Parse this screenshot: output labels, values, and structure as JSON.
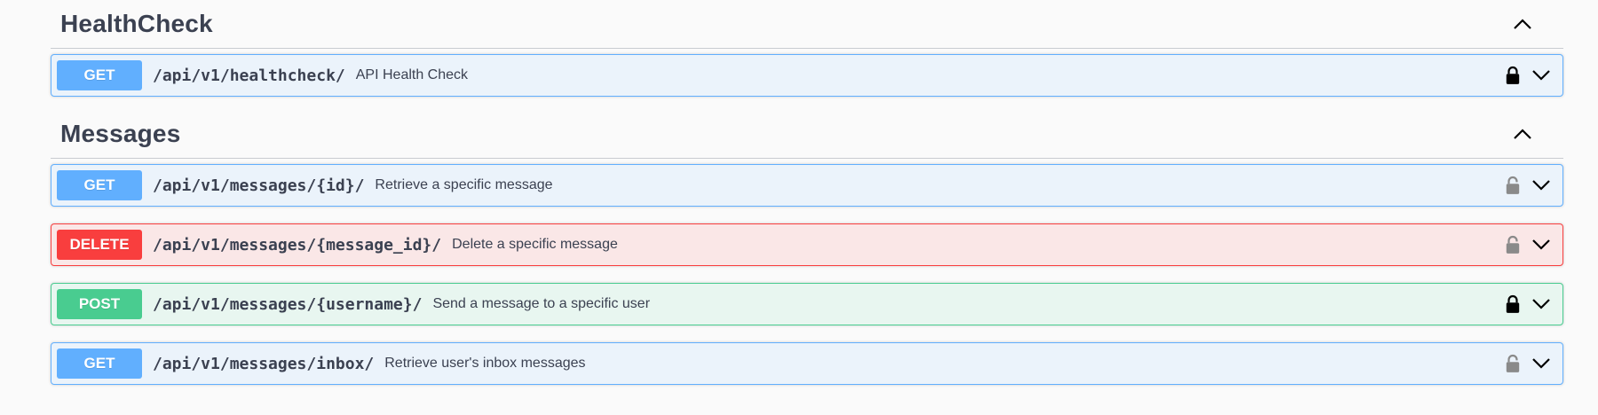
{
  "sections": [
    {
      "title": "HealthCheck",
      "ops": [
        {
          "method": "GET",
          "path": "/api/v1/healthcheck/",
          "summary": "API Health Check",
          "lock": "locked"
        }
      ]
    },
    {
      "title": "Messages",
      "ops": [
        {
          "method": "GET",
          "path": "/api/v1/messages/{id}/",
          "summary": "Retrieve a specific message",
          "lock": "unlocked"
        },
        {
          "method": "DELETE",
          "path": "/api/v1/messages/{message_id}/",
          "summary": "Delete a specific message",
          "lock": "unlocked"
        },
        {
          "method": "POST",
          "path": "/api/v1/messages/{username}/",
          "summary": "Send a message to a specific user",
          "lock": "locked"
        },
        {
          "method": "GET",
          "path": "/api/v1/messages/inbox/",
          "summary": "Retrieve user's inbox messages",
          "lock": "unlocked"
        }
      ]
    }
  ],
  "icons": {
    "section_toggle": "chevron-up-icon",
    "op_toggle": "chevron-down-icon",
    "lock_locked": "lock-closed-icon",
    "lock_unlocked": "lock-open-icon"
  },
  "colors": {
    "get": "#61affe",
    "delete": "#f93e3e",
    "post": "#49cc90",
    "lock_locked": "#000000",
    "lock_unlocked": "#8a8a8a"
  }
}
